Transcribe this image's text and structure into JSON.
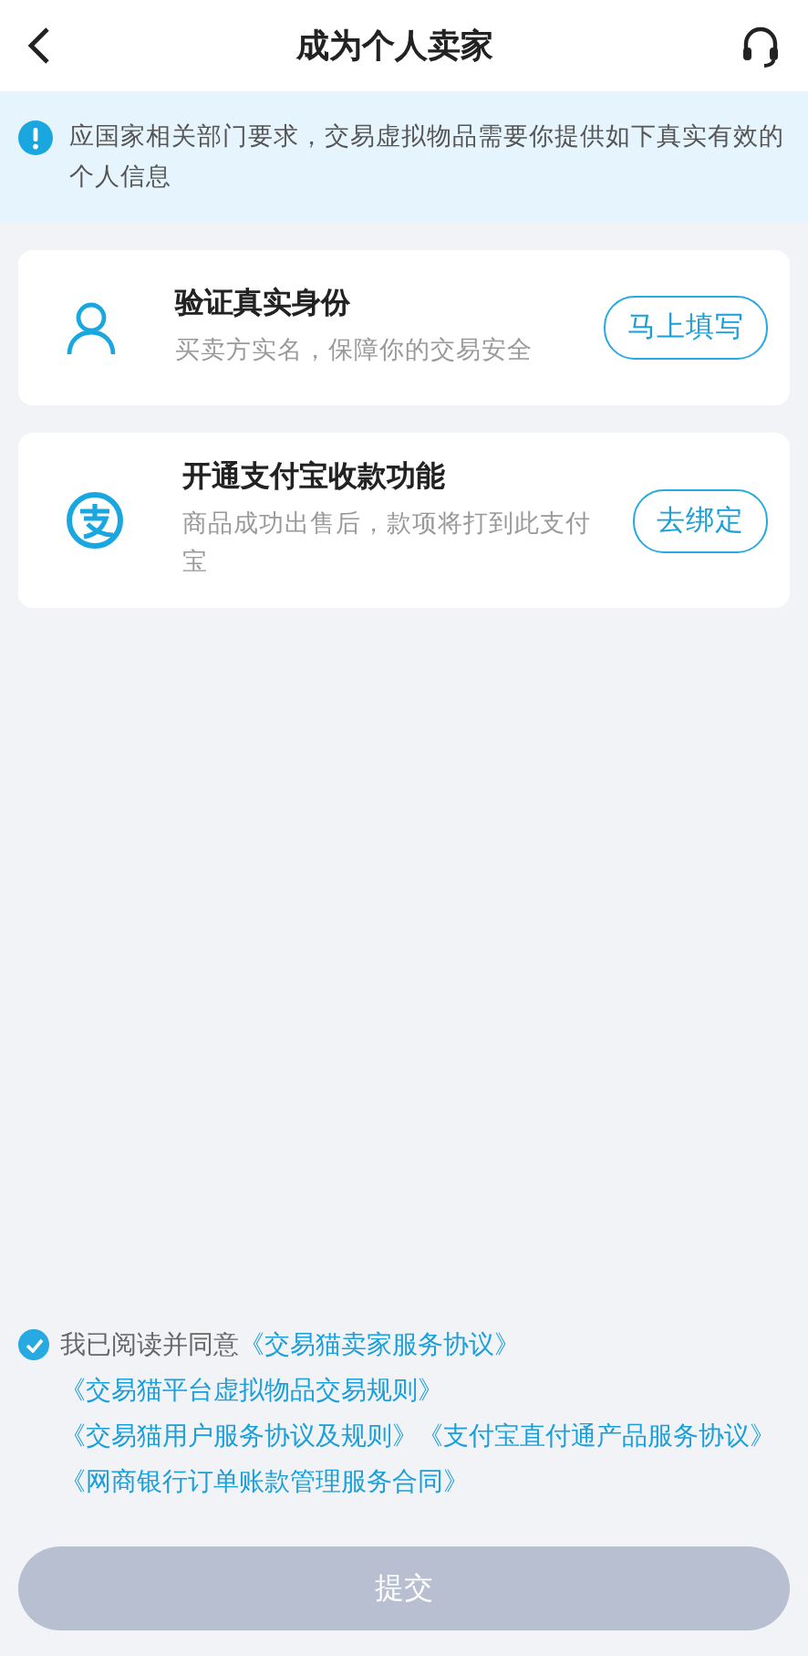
{
  "header": {
    "title": "成为个人卖家"
  },
  "notice": {
    "text": "应国家相关部门要求，交易虚拟物品需要你提供如下真实有效的个人信息"
  },
  "tasks": [
    {
      "kind": "identity",
      "title": "验证真实身份",
      "description": "买卖方实名，保障你的交易安全",
      "action": "马上填写"
    },
    {
      "kind": "alipay",
      "title": "开通支付宝收款功能",
      "description": "商品成功出售后，款项将打到此支付宝",
      "action": "去绑定"
    }
  ],
  "agreement": {
    "checked": true,
    "text": "我已阅读并同意",
    "links": [
      "《交易猫卖家服务协议》",
      "《交易猫平台虚拟物品交易规则》",
      "《交易猫用户服务协议及规则》",
      "《支付宝直付通产品服务协议》",
      "《网商银行订单账款管理服务合同》"
    ]
  },
  "submit": {
    "label": "提交",
    "disabled": true
  }
}
